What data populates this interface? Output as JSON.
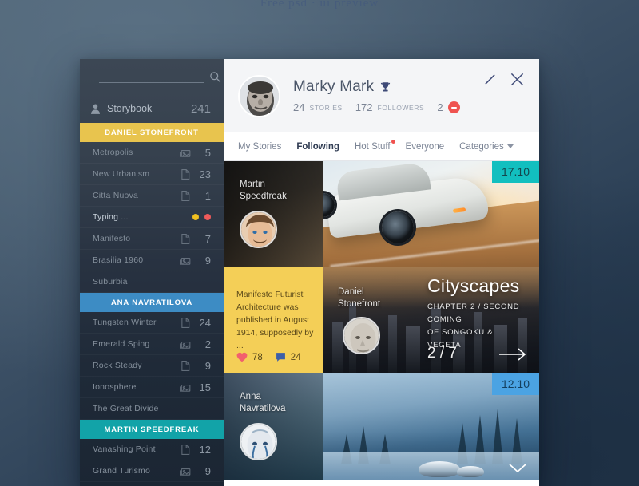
{
  "desktop": {
    "watermark": "Free psd · ui preview"
  },
  "sidebar": {
    "search_placeholder": "",
    "search_value": "",
    "storybook": {
      "label": "Storybook",
      "count": "241"
    },
    "groups": [
      {
        "header": "DANIEL STONEFRONT",
        "color": "#e8c44e",
        "items": [
          {
            "name": "Metropolis",
            "icon": "image-icon",
            "count": "5"
          },
          {
            "name": "New Urbanism",
            "icon": "document-icon",
            "count": "23"
          },
          {
            "name": "Citta Nuova",
            "icon": "document-icon",
            "count": "1"
          },
          {
            "name": "Typing ...",
            "icon": "typing-dots",
            "count": ""
          },
          {
            "name": "Manifesto",
            "icon": "document-icon",
            "count": "7"
          },
          {
            "name": "Brasilia 1960",
            "icon": "image-icon",
            "count": "9"
          },
          {
            "name": "Suburbia",
            "icon": "none",
            "count": ""
          }
        ]
      },
      {
        "header": "ANA NAVRATILOVA",
        "color": "#3d8cc4",
        "items": [
          {
            "name": "Tungsten Winter",
            "icon": "document-icon",
            "count": "24"
          },
          {
            "name": "Emerald Sping",
            "icon": "image-icon",
            "count": "2"
          },
          {
            "name": "Rock Steady",
            "icon": "document-icon",
            "count": "9"
          },
          {
            "name": "Ionosphere",
            "icon": "image-icon",
            "count": "15"
          },
          {
            "name": "The Great Divide",
            "icon": "none",
            "count": ""
          }
        ]
      },
      {
        "header": "MARTIN SPEEDFREAK",
        "color": "#12a3a8",
        "items": [
          {
            "name": "Vanashing Point",
            "icon": "document-icon",
            "count": "12"
          },
          {
            "name": "Grand Turismo",
            "icon": "image-icon",
            "count": "9"
          }
        ]
      }
    ]
  },
  "profile": {
    "name": "Marky Mark",
    "stories_count": "24",
    "stories_label": "STORIES",
    "followers_count": "172",
    "followers_label": "FOLLOWERS",
    "notifications_count": "2"
  },
  "tabs": [
    {
      "label": "My Stories",
      "active": false,
      "dot": false
    },
    {
      "label": "Following",
      "active": true,
      "dot": false
    },
    {
      "label": "Hot Stuff",
      "active": false,
      "dot": true
    },
    {
      "label": "Everyone",
      "active": false,
      "dot": false
    },
    {
      "label": "Categories",
      "active": false,
      "dot": false,
      "caret": true
    }
  ],
  "feed": {
    "cards": [
      {
        "id": "card-speedfreak",
        "author": "Martin\nSpeedfreak",
        "author_line1": "Martin",
        "author_line2": "Speedfreak",
        "date_badge": "17.10",
        "badge_color": "#12bfbf"
      },
      {
        "id": "card-manifesto",
        "excerpt": "Manifesto Futurist Architecture was published in August 1914, supposedly by ...",
        "likes": "78",
        "comments": "24",
        "author_line1": "Daniel",
        "author_line2": "Stonefront",
        "title": "Cityscapes",
        "subtitle_line1": "CHAPTER 2 / SECOND COMING",
        "subtitle_line2": "OF SONGOKU & VEGETA",
        "pager": "2 / 7"
      },
      {
        "id": "card-winter",
        "author_line1": "Anna",
        "author_line2": "Navratilova",
        "date_badge": "12.10",
        "badge_color": "#4ba3e3"
      }
    ]
  }
}
